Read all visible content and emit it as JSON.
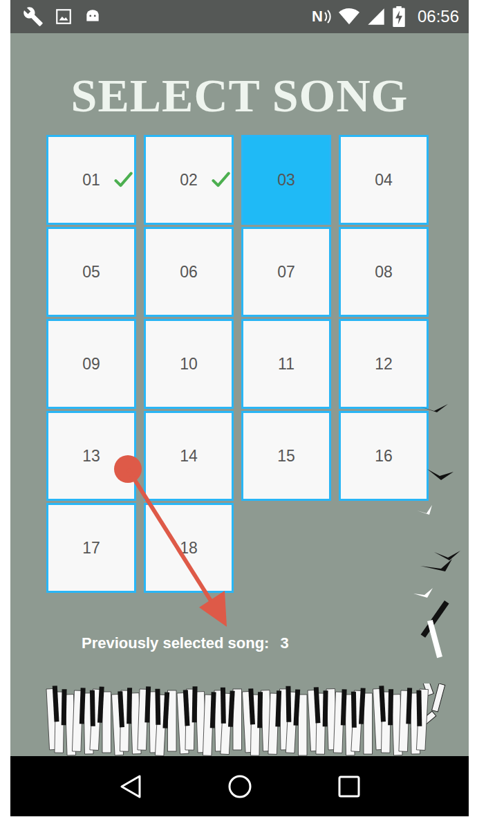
{
  "status_bar": {
    "nfc": "N",
    "time": "06:56"
  },
  "title": "SELECT SONG",
  "songs": [
    {
      "number": "01",
      "completed": true,
      "selected": false
    },
    {
      "number": "02",
      "completed": true,
      "selected": false
    },
    {
      "number": "03",
      "completed": false,
      "selected": true
    },
    {
      "number": "04",
      "completed": false,
      "selected": false
    },
    {
      "number": "05",
      "completed": false,
      "selected": false
    },
    {
      "number": "06",
      "completed": false,
      "selected": false
    },
    {
      "number": "07",
      "completed": false,
      "selected": false
    },
    {
      "number": "08",
      "completed": false,
      "selected": false
    },
    {
      "number": "09",
      "completed": false,
      "selected": false
    },
    {
      "number": "10",
      "completed": false,
      "selected": false
    },
    {
      "number": "11",
      "completed": false,
      "selected": false
    },
    {
      "number": "12",
      "completed": false,
      "selected": false
    },
    {
      "number": "13",
      "completed": false,
      "selected": false
    },
    {
      "number": "14",
      "completed": false,
      "selected": false
    },
    {
      "number": "15",
      "completed": false,
      "selected": false
    },
    {
      "number": "16",
      "completed": false,
      "selected": false
    },
    {
      "number": "17",
      "completed": false,
      "selected": false
    },
    {
      "number": "18",
      "completed": false,
      "selected": false
    }
  ],
  "previous": {
    "label": "Previously selected song:",
    "value": "3"
  }
}
